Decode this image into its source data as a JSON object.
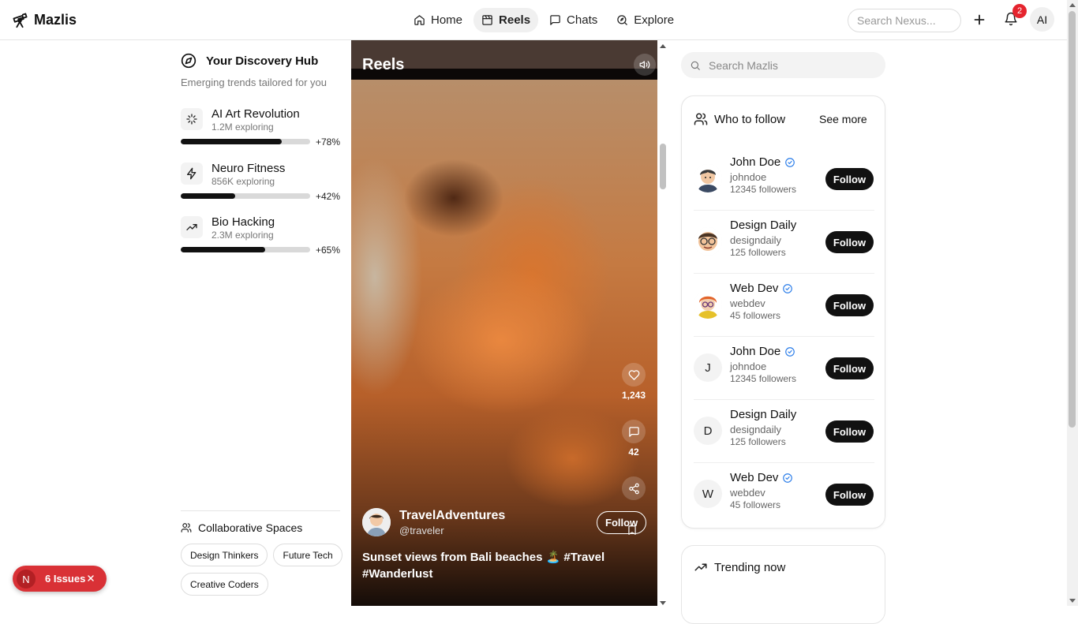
{
  "app": {
    "name": "Mazlis"
  },
  "nav": {
    "items": [
      {
        "label": "Home",
        "icon": "home-icon"
      },
      {
        "label": "Reels",
        "icon": "film-icon",
        "active": true
      },
      {
        "label": "Chats",
        "icon": "chat-icon"
      },
      {
        "label": "Explore",
        "icon": "explore-icon"
      }
    ]
  },
  "header": {
    "search_placeholder": "Search Nexus...",
    "notification_count": "2",
    "avatar_initials": "AI"
  },
  "discovery": {
    "title": "Your Discovery Hub",
    "subtitle": "Emerging trends tailored for you",
    "trends": [
      {
        "name": "AI Art Revolution",
        "count": "1.2M exploring",
        "growth": "+78%",
        "progress": 0.78,
        "icon": "sparkles-icon"
      },
      {
        "name": "Neuro Fitness",
        "count": "856K exploring",
        "growth": "+42%",
        "progress": 0.42,
        "icon": "zap-icon"
      },
      {
        "name": "Bio Hacking",
        "count": "2.3M exploring",
        "growth": "+65%",
        "progress": 0.65,
        "icon": "trending-up-icon"
      }
    ]
  },
  "collab": {
    "title": "Collaborative Spaces",
    "spaces": [
      "Design Thinkers",
      "Future Tech",
      "Creative Coders"
    ]
  },
  "reel": {
    "title": "Reels",
    "likes": "1,243",
    "comments": "42",
    "user": "TravelAdventures",
    "handle": "@traveler",
    "follow_label": "Follow",
    "caption": "Sunset views from Bali beaches 🏝️ #Travel #Wanderlust"
  },
  "right": {
    "search_placeholder": "Search Mazlis",
    "who_to_follow": "Who to follow",
    "see_more": "See more",
    "follow_label": "Follow",
    "people": [
      {
        "name": "John Doe",
        "handle": "johndoe",
        "followers": "12345 followers",
        "verified": true,
        "avatar": "cartoon-1"
      },
      {
        "name": "Design Daily",
        "handle": "designdaily",
        "followers": "125 followers",
        "verified": false,
        "avatar": "cartoon-2"
      },
      {
        "name": "Web Dev",
        "handle": "webdev",
        "followers": "45 followers",
        "verified": true,
        "avatar": "cartoon-3"
      },
      {
        "name": "John Doe",
        "handle": "johndoe",
        "followers": "12345 followers",
        "verified": true,
        "initial": "J"
      },
      {
        "name": "Design Daily",
        "handle": "designdaily",
        "followers": "125 followers",
        "verified": false,
        "initial": "D"
      },
      {
        "name": "Web Dev",
        "handle": "webdev",
        "followers": "45 followers",
        "verified": true,
        "initial": "W"
      }
    ],
    "trending_title": "Trending now"
  },
  "issues": {
    "initial": "N",
    "label": "6 Issues"
  }
}
